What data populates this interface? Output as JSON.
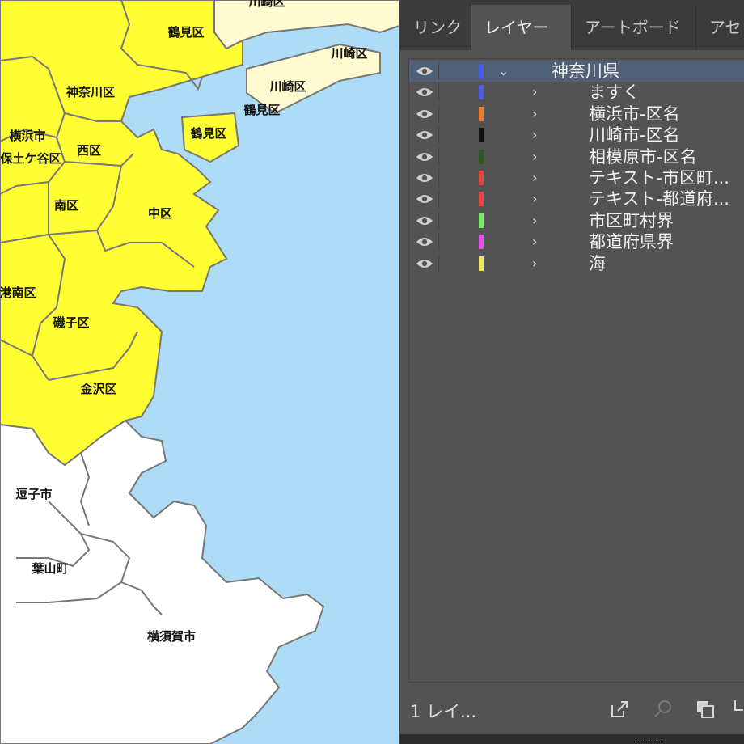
{
  "map": {
    "regions": [
      {
        "name": "tsurumi-ku-label-1",
        "label": "鶴見区"
      },
      {
        "name": "kanagawa-ku-label",
        "label": "神奈川区"
      },
      {
        "name": "yokohama-city-label",
        "label": "横浜市"
      },
      {
        "name": "hodogaya-ku-label",
        "label": "保土ケ谷区"
      },
      {
        "name": "nishi-ku-label",
        "label": "西区"
      },
      {
        "name": "minami-ku-label",
        "label": "南区"
      },
      {
        "name": "naka-ku-label",
        "label": "中区"
      },
      {
        "name": "konan-ku-label",
        "label": "港南区"
      },
      {
        "name": "isogo-ku-label",
        "label": "磯子区"
      },
      {
        "name": "kanazawa-ku-label",
        "label": "金沢区"
      },
      {
        "name": "kawasaki-ku-label-1",
        "label": "川崎区"
      },
      {
        "name": "kawasaki-ku-label-2",
        "label": "川崎区"
      },
      {
        "name": "kawasaki-ku-label-3",
        "label": "川崎区"
      },
      {
        "name": "tsurumi-ku-label-2",
        "label": "鶴見区"
      },
      {
        "name": "tsurumi-ku-label-3",
        "label": "鶴見区"
      },
      {
        "name": "zushi-label",
        "label": "逗子市"
      },
      {
        "name": "hayama-label",
        "label": "葉山町"
      },
      {
        "name": "yokosuka-label",
        "label": "横須賀市"
      }
    ]
  },
  "panel": {
    "tabs": [
      {
        "label": "リンク",
        "active": false
      },
      {
        "label": "レイヤー",
        "active": true
      },
      {
        "label": "アートボード",
        "active": false
      },
      {
        "label": "アセ",
        "active": false
      }
    ],
    "layers": [
      {
        "name": "神奈川県",
        "color": "#4a5cf0",
        "expanded": true,
        "selected": true,
        "level": 0
      },
      {
        "name": "ますく",
        "color": "#4a5cf0",
        "expanded": false,
        "selected": false,
        "level": 1
      },
      {
        "name": "横浜市-区名",
        "color": "#f07a2a",
        "expanded": false,
        "selected": false,
        "level": 1
      },
      {
        "name": "川崎市-区名",
        "color": "#111111",
        "expanded": false,
        "selected": false,
        "level": 1
      },
      {
        "name": "相模原市-区名",
        "color": "#2c5a1e",
        "expanded": false,
        "selected": false,
        "level": 1
      },
      {
        "name": "テキスト-市区町...",
        "color": "#e8463c",
        "expanded": false,
        "selected": false,
        "level": 1
      },
      {
        "name": "テキスト-都道府...",
        "color": "#e8463c",
        "expanded": false,
        "selected": false,
        "level": 1
      },
      {
        "name": "市区町村界",
        "color": "#6ef05a",
        "expanded": false,
        "selected": false,
        "level": 1
      },
      {
        "name": "都道府県界",
        "color": "#e84ef0",
        "expanded": false,
        "selected": false,
        "level": 1
      },
      {
        "name": "海",
        "color": "#f0e85a",
        "expanded": false,
        "selected": false,
        "level": 1
      }
    ],
    "footer": {
      "layer_count": "1 レイ...",
      "icons": [
        "export-icon",
        "search-icon",
        "merge-icon",
        "arrow-icon"
      ]
    }
  }
}
